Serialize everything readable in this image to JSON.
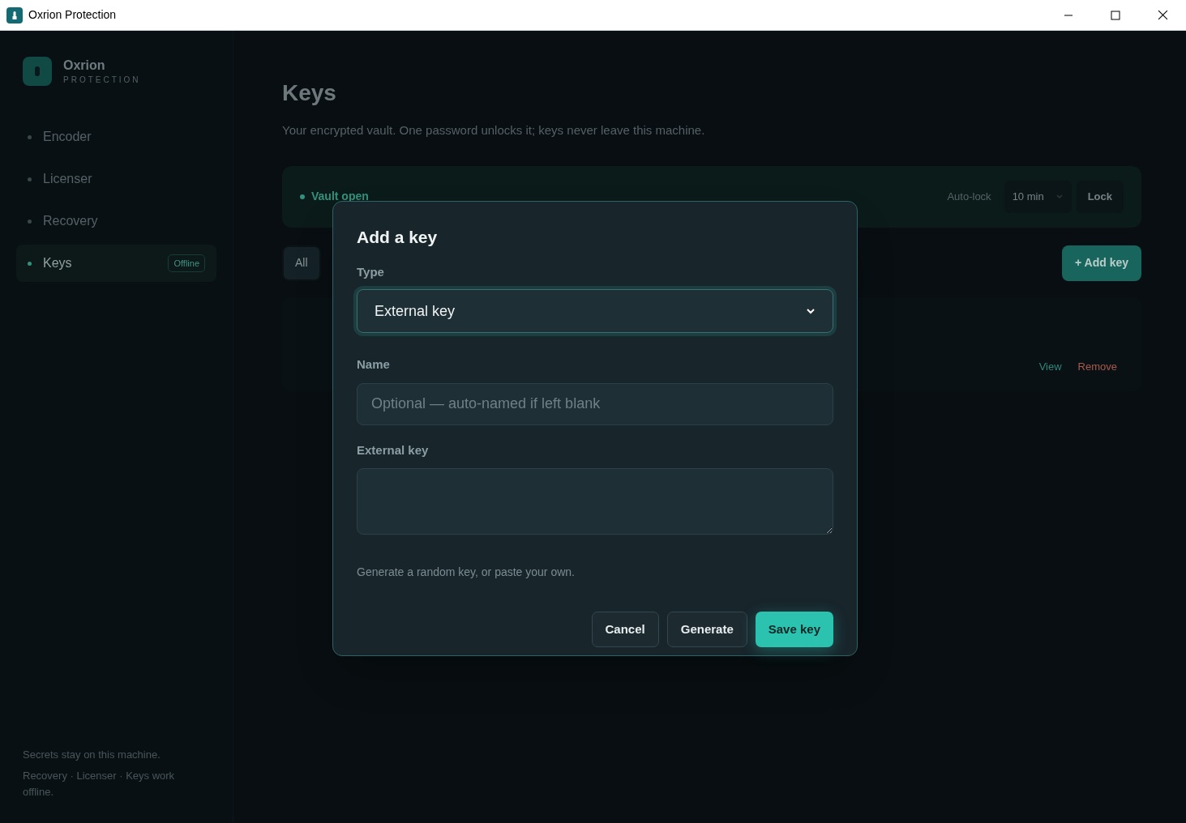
{
  "window": {
    "title": "Oxrion Protection"
  },
  "sidebar": {
    "brand": "Oxrion",
    "tagline": "PROTECTION",
    "items": [
      {
        "label": "Encoder",
        "selected": false
      },
      {
        "label": "Licenser",
        "selected": false
      },
      {
        "label": "Recovery",
        "selected": false
      },
      {
        "label": "Keys",
        "selected": true,
        "badge": "Offline"
      }
    ],
    "footer": [
      "Secrets stay on this machine.",
      "Recovery · Licenser · Keys work offline."
    ]
  },
  "page": {
    "title": "Keys",
    "subtitle": "Your encrypted vault. One password unlocks it; keys never leave this machine.",
    "vault": {
      "status": "Vault open",
      "autolock_label": "Auto-lock",
      "autolock_value": "10 min",
      "lock_button": "Lock"
    },
    "filters": [
      {
        "label": "All",
        "selected": true
      }
    ],
    "add_button": "+ Add key",
    "row_actions": [
      "View",
      "Remove"
    ]
  },
  "dialog": {
    "title": "Add a key",
    "type": {
      "label": "Type",
      "value": "External key"
    },
    "name": {
      "label": "Name",
      "placeholder": "Optional — auto-named if left blank"
    },
    "key": {
      "label": "External key"
    },
    "hint": "Generate a random key, or paste your own.",
    "buttons": [
      {
        "label": "Cancel",
        "kind": "secondary"
      },
      {
        "label": "Generate",
        "kind": "secondary"
      },
      {
        "label": "Save key",
        "kind": "primary"
      }
    ]
  }
}
